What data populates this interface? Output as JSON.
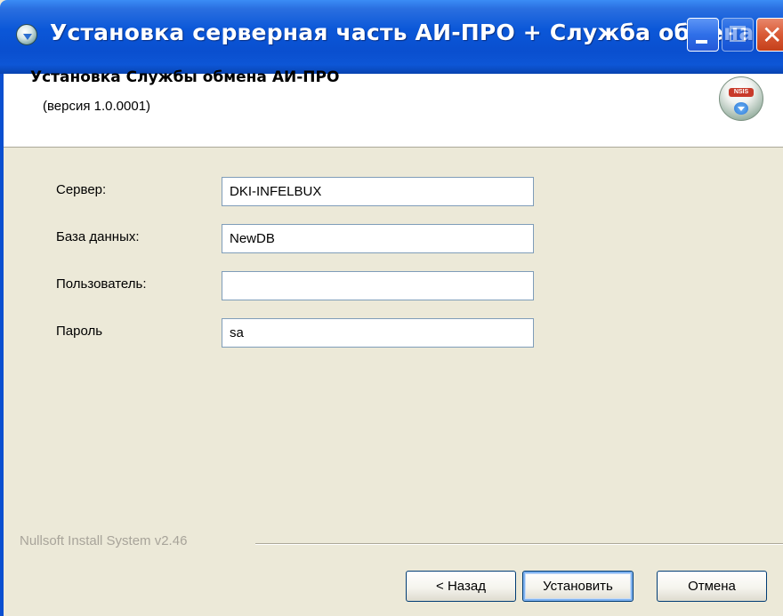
{
  "window": {
    "title": "Установка серверная часть АИ-ПРО + Служба обмена",
    "colors": {
      "titlebar": "#0b57d8",
      "body": "#ece9d8",
      "close": "#d95a36"
    },
    "icons": [
      "installer-icon",
      "minimize-icon",
      "maximize-icon",
      "close-icon"
    ],
    "close_glyph": "✕"
  },
  "header": {
    "title": "Установка Службы обмена АИ-ПРО",
    "subtitle": "(версия 1.0.0001)",
    "icon": "nsis-install-icon",
    "icon_badge": "NSIS"
  },
  "form": {
    "server_label": "Сервер:",
    "server_value": "DKI-INFELBUX",
    "database_label": "База данных:",
    "database_value": "NewDB",
    "user_label": "Пользователь:",
    "user_value": "",
    "password_label": "Пароль",
    "password_value": "sa"
  },
  "footer": {
    "brand": "Nullsoft Install System v2.46",
    "back_label": "< Назад",
    "install_label": "Установить",
    "cancel_label": "Отмена"
  }
}
